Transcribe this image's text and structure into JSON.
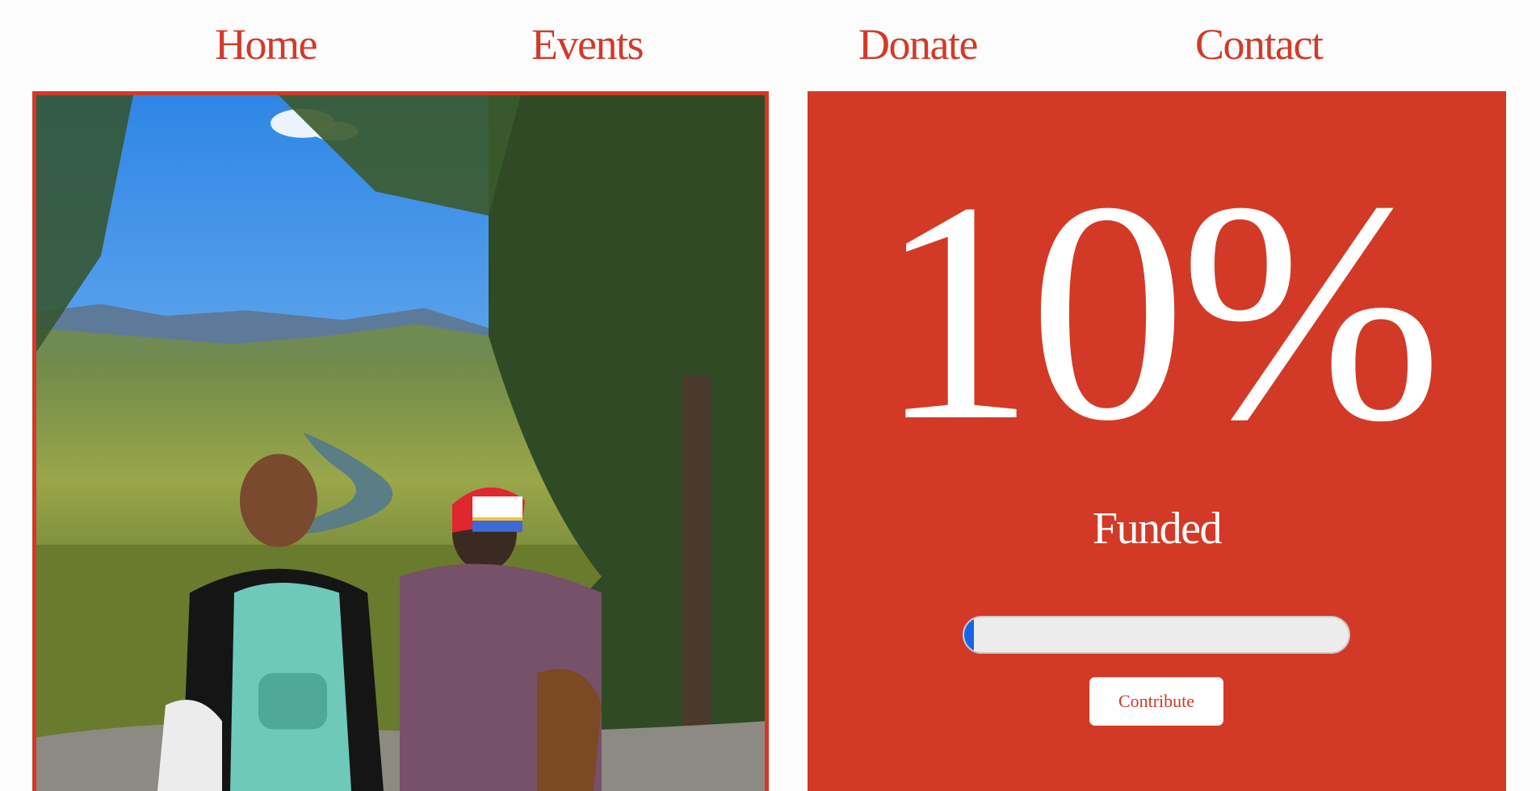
{
  "nav": {
    "home": "Home",
    "events": "Events",
    "donate": "Donate",
    "contact": "Contact"
  },
  "funding": {
    "percent_text": "10%",
    "status_label": "Funded",
    "progress_fraction": 0.025,
    "contribute_label": "Contribute"
  },
  "colors": {
    "brand_red": "#d23a27",
    "progress_fill": "#1565e8",
    "progress_track": "#ececec",
    "background": "#fcfcfd"
  }
}
